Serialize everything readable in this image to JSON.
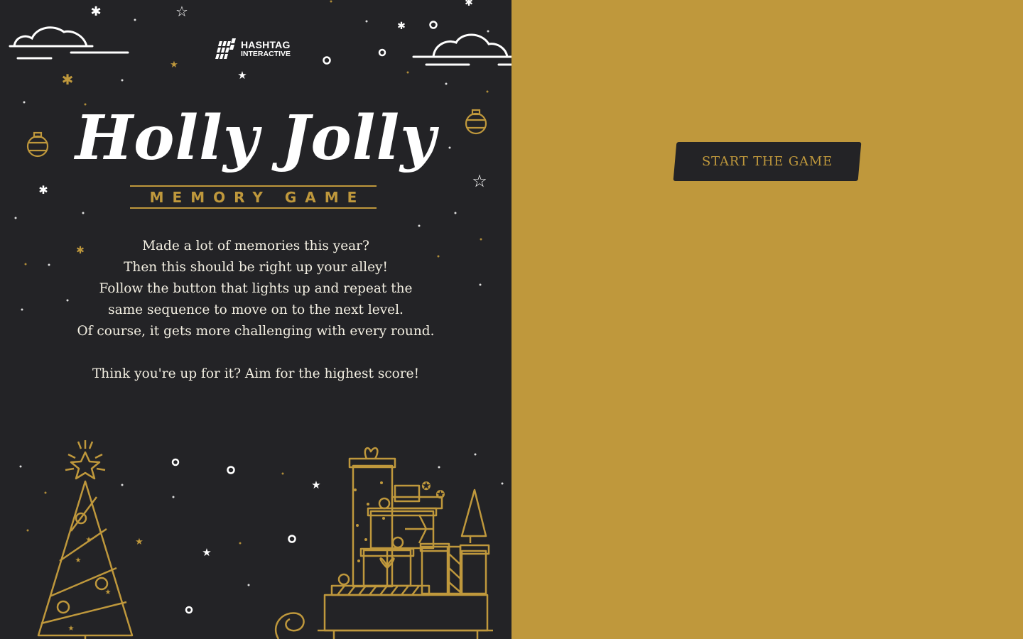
{
  "colors": {
    "panel": "#232326",
    "gold": "#bf983c",
    "text": "#f3efe2"
  },
  "brand": {
    "name": "HASHTAG",
    "sub": "INTERACTIVE"
  },
  "title": "Holly Jolly",
  "subtitle": "MEMORY GAME",
  "description": [
    "Made a lot of memories this year?",
    "Then this should be right up your alley!",
    "Follow the button that lights up and repeat the",
    "same sequence to move on to the next level.",
    "Of course, it gets more challenging with every round."
  ],
  "tagline": "Think you're up for it? Aim for the highest score!",
  "start_button": {
    "label": "START THE GAME"
  },
  "icons": [
    "hashtag-logo-icon",
    "cloud-icon",
    "star-icon",
    "ornament-icon",
    "christmas-tree-icon",
    "gift-stack-icon"
  ]
}
